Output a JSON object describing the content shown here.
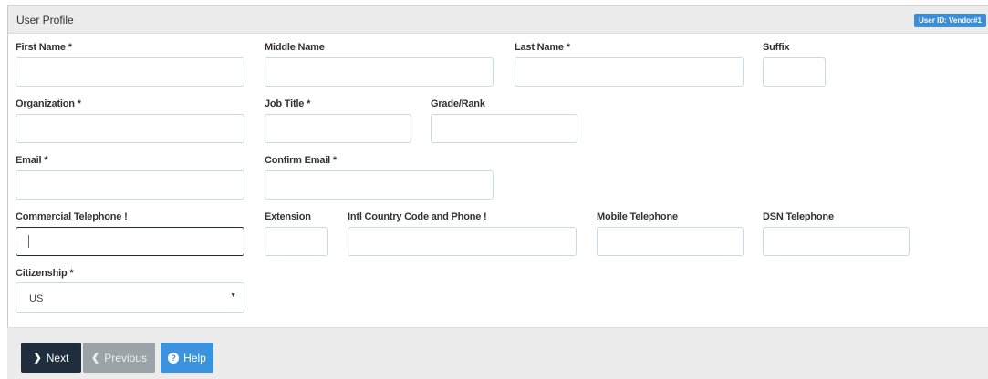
{
  "panel": {
    "title": "User Profile",
    "user_badge": "User ID: Vendor#1"
  },
  "labels": {
    "first_name": "First Name *",
    "middle_name": "Middle Name",
    "last_name": "Last Name *",
    "suffix": "Suffix",
    "organization": "Organization *",
    "job_title": "Job Title *",
    "grade_rank": "Grade/Rank",
    "email": "Email *",
    "confirm_email": "Confirm Email *",
    "commercial_phone": "Commercial Telephone !",
    "extension": "Extension",
    "intl_phone": "Intl Country Code and Phone !",
    "mobile_phone": "Mobile Telephone",
    "dsn_phone": "DSN Telephone",
    "citizenship": "Citizenship *"
  },
  "fields": {
    "first_name": "",
    "middle_name": "",
    "last_name": "",
    "suffix": "",
    "organization": "",
    "job_title": "",
    "grade_rank": "",
    "email": "",
    "confirm_email": "",
    "commercial_phone": "",
    "extension": "",
    "intl_phone": "",
    "mobile_phone": "",
    "dsn_phone": "",
    "citizenship": "US"
  },
  "buttons": {
    "next": "Next",
    "previous": "Previous",
    "help": "Help"
  },
  "icons": {
    "next": "chevron-right-icon",
    "previous": "chevron-left-icon",
    "help": "question-circle-icon",
    "dropdown": "caret-down-icon"
  },
  "colors": {
    "next_bg": "#1f2e3d",
    "previous_bg": "#9ba3a6",
    "help_bg": "#3a93dc",
    "badge_bg": "#3c8dd6"
  }
}
